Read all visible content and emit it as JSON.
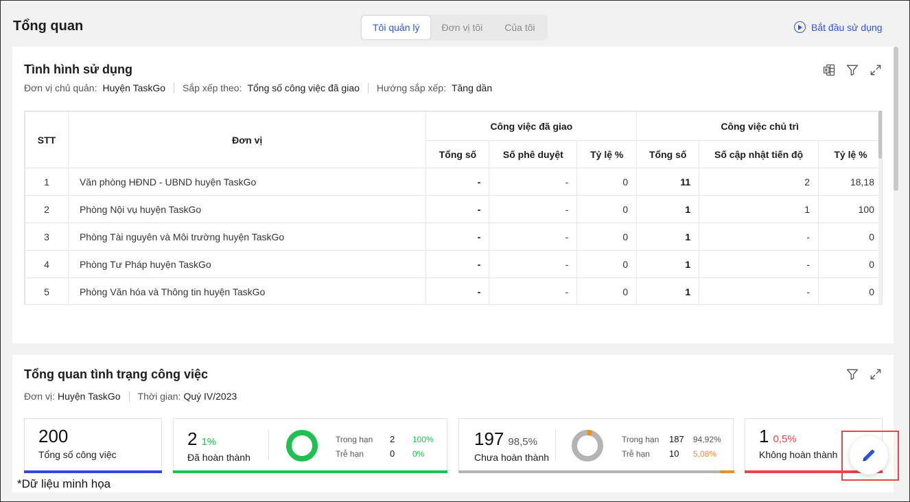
{
  "header": {
    "title": "Tổng quan",
    "tabs": [
      "Tôi quản lý",
      "Đơn vị tôi",
      "Của tôi"
    ],
    "start_link": "Bắt đầu sử dụng"
  },
  "usage": {
    "title": "Tình hình sử dụng",
    "unit_label": "Đơn vị chủ quản:",
    "unit_value": "Huyện TaskGo",
    "sort_label": "Sắp xếp theo:",
    "sort_value": "Tổng số công việc đã giao",
    "order_label": "Hướng sắp xếp:",
    "order_value": "Tăng dần",
    "table": {
      "col_stt": "STT",
      "col_unit": "Đơn vị",
      "group_assigned": "Công việc đã giao",
      "group_chaired": "Công việc chủ trì",
      "sub_total": "Tổng số",
      "sub_approved": "Số phê duyệt",
      "sub_rate": "Tỷ lệ %",
      "sub_total2": "Tổng số",
      "sub_updated": "Số cập nhật tiến độ",
      "sub_rate2": "Tỷ lệ %",
      "rows": [
        {
          "stt": "1",
          "unit": "Văn phòng HĐND - UBND huyện TaskGo",
          "a_total": "-",
          "a_approved": "-",
          "a_rate": "0",
          "c_total": "11",
          "c_updated": "2",
          "c_rate": "18,18"
        },
        {
          "stt": "2",
          "unit": "Phòng Nội vụ huyện TaskGo",
          "a_total": "-",
          "a_approved": "-",
          "a_rate": "0",
          "c_total": "1",
          "c_updated": "1",
          "c_rate": "100"
        },
        {
          "stt": "3",
          "unit": "Phòng Tài nguyên và Môi trường huyện TaskGo",
          "a_total": "-",
          "a_approved": "-",
          "a_rate": "0",
          "c_total": "1",
          "c_updated": "-",
          "c_rate": "0"
        },
        {
          "stt": "4",
          "unit": "Phòng Tư Pháp huyện TaskGo",
          "a_total": "-",
          "a_approved": "-",
          "a_rate": "0",
          "c_total": "1",
          "c_updated": "-",
          "c_rate": "0"
        },
        {
          "stt": "5",
          "unit": "Phòng Văn hóa và Thông tin huyện TaskGo",
          "a_total": "-",
          "a_approved": "-",
          "a_rate": "0",
          "c_total": "1",
          "c_updated": "-",
          "c_rate": "0"
        }
      ]
    }
  },
  "overview": {
    "title": "Tổng quan tình trạng công việc",
    "unit_label": "Đơn vị:",
    "unit_value": "Huyện TaskGo",
    "time_label": "Thời gian:",
    "time_value": "Quý IV/2023",
    "total": {
      "value": "200",
      "label": "Tổng số công việc"
    },
    "done": {
      "value": "2",
      "pct": "1%",
      "label": "Đã hoàn thành",
      "ontime_label": "Trong hạn",
      "ontime_value": "2",
      "ontime_pct": "100%",
      "late_label": "Trễ hạn",
      "late_value": "0",
      "late_pct": "0%"
    },
    "pending": {
      "value": "197",
      "pct": "98,5%",
      "label": "Chưa hoàn thành",
      "ontime_label": "Trong hạn",
      "ontime_value": "187",
      "ontime_pct": "94,92%",
      "late_label": "Trễ hạn",
      "late_value": "10",
      "late_pct": "5,08%"
    },
    "failed": {
      "value": "1",
      "pct": "0,5%",
      "label": "Không hoàn thành"
    }
  },
  "footnote": "*Dữ liệu minh họa",
  "colors": {
    "accent": "#2f55d4",
    "green": "#1ec150",
    "grey": "#b4b4b4",
    "orange": "#f28c1e",
    "red": "#e64646"
  }
}
